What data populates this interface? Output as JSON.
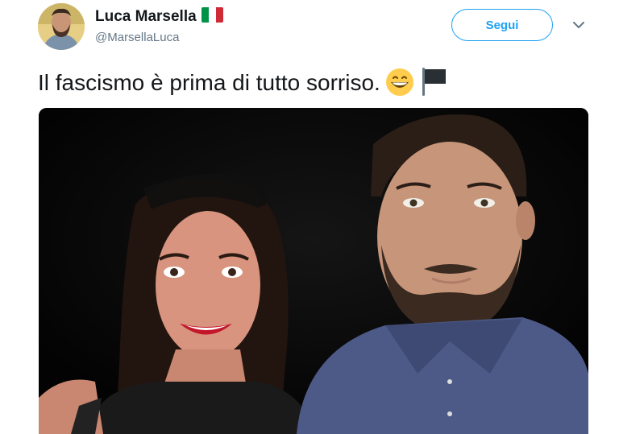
{
  "tweet": {
    "author": {
      "display_name": "Luca Marsella",
      "handle": "@MarsellaLuca",
      "flag_icon": "italy-flag-icon",
      "avatar_icon": "profile-photo"
    },
    "follow_label": "Segui",
    "menu_icon": "chevron-down-icon",
    "text": "Il fascismo è prima di tutto sorriso.",
    "emojis": [
      "grinning-face-icon",
      "black-flag-icon"
    ],
    "media": {
      "type": "photo",
      "description_icon": "photo-of-two-people-smiling"
    }
  },
  "colors": {
    "accent": "#1da1f2",
    "text": "#14171a",
    "secondary_text": "#657786",
    "flag_green": "#009246",
    "flag_white": "#ffffff",
    "flag_red": "#ce2b37"
  }
}
